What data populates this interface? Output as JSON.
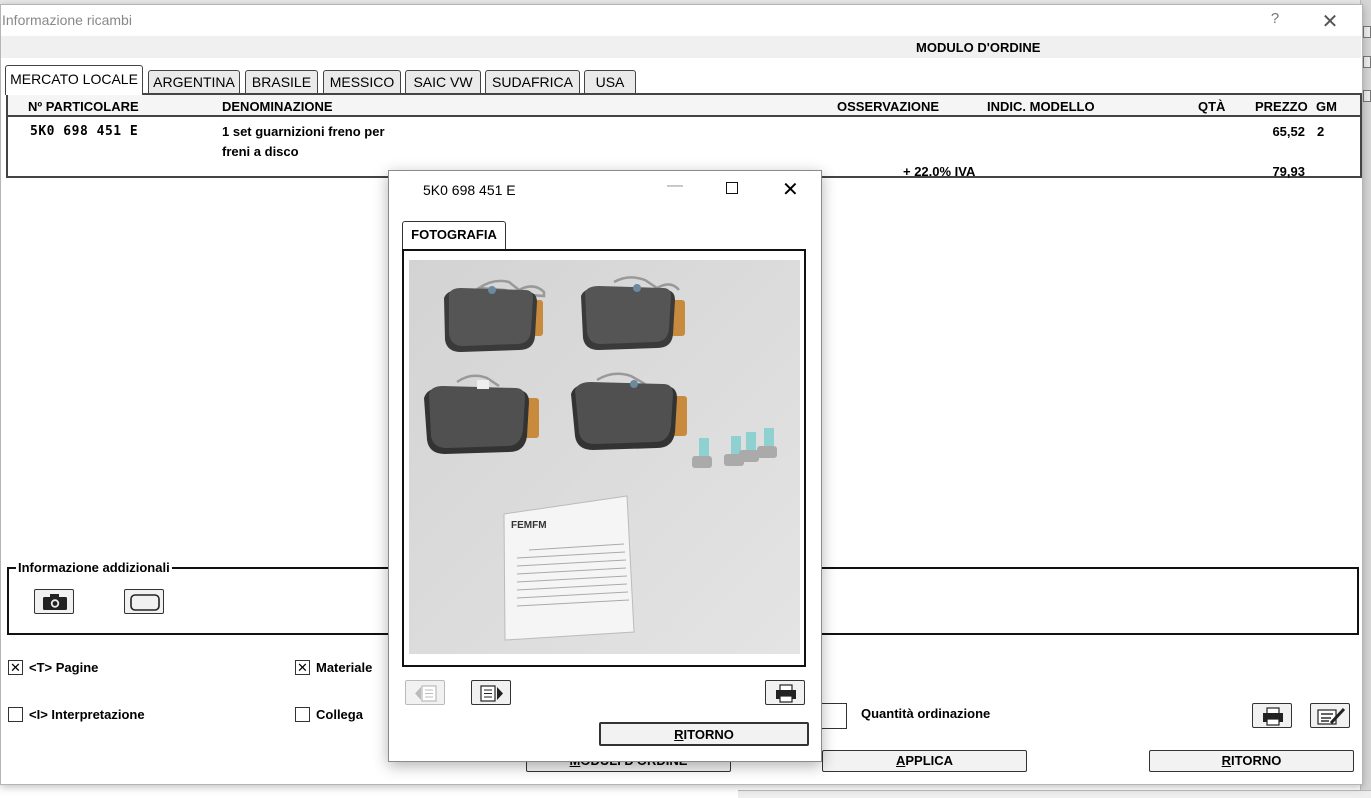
{
  "window": {
    "title": "Informazione ricambi",
    "help": "?",
    "close": "✕"
  },
  "order_header": "MODULO D'ORDINE",
  "tabs": [
    "MERCATO LOCALE",
    "ARGENTINA",
    "BRASILE",
    "MESSICO",
    "SAIC VW",
    "SUDAFRICA",
    "USA"
  ],
  "table": {
    "headers": [
      "Nº PARTICOLARE",
      "DENOMINAZIONE",
      "OSSERVAZIONE",
      "INDIC. MODELLO",
      "QTÀ",
      "PREZZO",
      "GM"
    ],
    "row": {
      "part_number": "5K0 698 451 E",
      "desc_line1": "1 set guarnizioni freno per",
      "desc_line2": "freni a disco",
      "price": "65,52",
      "gm": "2",
      "vat_label": "+ 22.0% IVA",
      "price_vat": "79,93"
    }
  },
  "additional_info": {
    "label": "Informazione addizionali"
  },
  "checkboxes": {
    "pagine": {
      "label": "<T> Pagine",
      "checked": true
    },
    "materiale": {
      "label": "Materiale",
      "checked": true
    },
    "interpretazione": {
      "label": "<I> Interpretazione",
      "checked": false
    },
    "collega": {
      "label": "Collega",
      "checked": false
    }
  },
  "quantity_label": "Quantità ordinazione",
  "buttons": {
    "moduli": "MODULI D'ORDINE",
    "applica": "APPLICA",
    "ritorno": "RITORNO"
  },
  "dialog": {
    "title": "5K0 698 451 E",
    "tab": "FOTOGRAFIA",
    "ritorno": "RITORNO",
    "leaflet_text": "FEMFM"
  },
  "colors": {
    "pad": "#4a4a4a",
    "photo_bg": "#dcdcdc",
    "bolt_cap": "#8fd0d0"
  }
}
